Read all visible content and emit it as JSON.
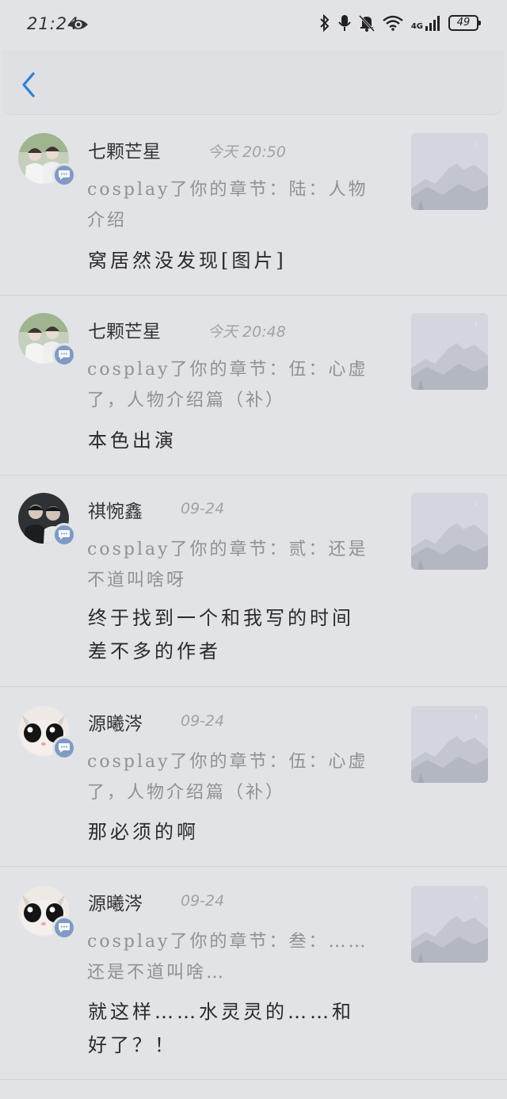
{
  "status_bar": {
    "time": "21:24",
    "network": "4G",
    "battery": "49"
  },
  "notifications": [
    {
      "name": "七颗芒星",
      "time": "今天  20:50",
      "description": "cosplay了你的章节：陆：人物介绍",
      "comment": "窝居然没发现[图片]"
    },
    {
      "name": "七颗芒星",
      "time": "今天  20:48",
      "description": "cosplay了你的章节：伍：心虚了，人物介绍篇（补）",
      "comment": "本色出演"
    },
    {
      "name": "祺惋鑫",
      "time": "09-24",
      "description": "cosplay了你的章节：贰：还是不道叫啥呀",
      "comment": "终于找到一个和我写的时间差不多的作者"
    },
    {
      "name": "源曦涔",
      "time": "09-24",
      "description": "cosplay了你的章节：伍：心虚了，人物介绍篇（补）",
      "comment": "那必须的啊"
    },
    {
      "name": "源曦涔",
      "time": "09-24",
      "description": "cosplay了你的章节：叁：……还是不道叫啥…",
      "comment": "就这样……水灵灵的……和好了？！"
    }
  ],
  "colors": {
    "accent": "#2f7fd0",
    "badge": "#7f9ac4",
    "background": "#e2e3e6"
  },
  "icons": {
    "back": "chevron-left-icon",
    "badge": "comment-bubble-icon",
    "thumbnail": "mountain-placeholder-icon"
  }
}
